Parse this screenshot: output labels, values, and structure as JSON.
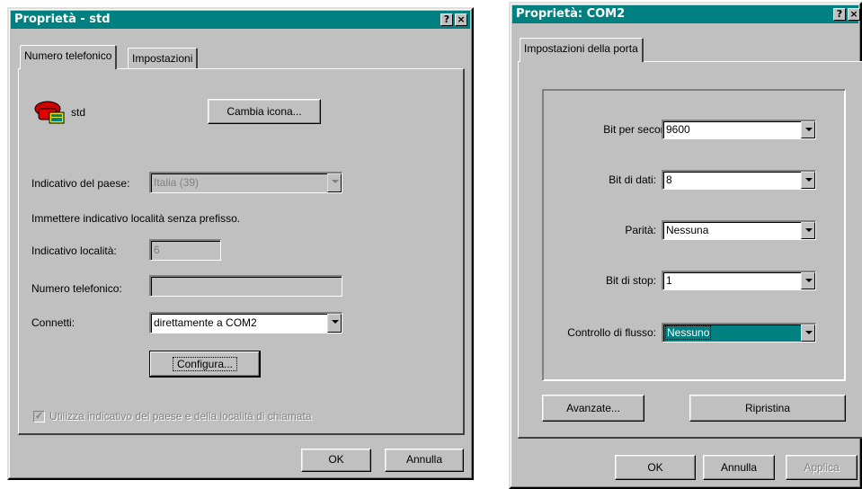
{
  "left_window": {
    "title": "Proprietà - std",
    "help_glyph": "?",
    "close_glyph": "×",
    "tabs": [
      "Numero telefonico",
      "Impostazioni"
    ],
    "connection_name": "std",
    "change_icon_button": "Cambia icona...",
    "country_code_label": "Indicativo del paese:",
    "country_code_value": "Italia (39)",
    "hint_text": "Immettere indicativo località senza prefisso.",
    "area_code_label": "Indicativo località:",
    "area_code_value": "6",
    "phone_number_label": "Numero telefonico:",
    "phone_number_value": "",
    "connect_label": "Connetti:",
    "connect_value": "direttamente a COM2",
    "configure_button": "Configura...",
    "use_codes_checkbox": "Utilizza indicativo del paese e della località di chiamata",
    "ok_button": "OK",
    "cancel_button": "Annulla"
  },
  "right_window": {
    "title": "Proprietà: COM2",
    "help_glyph": "?",
    "close_glyph": "×",
    "tabs": [
      "Impostazioni della porta"
    ],
    "bits_per_second_label": "Bit per secondo:",
    "bits_per_second_value": "9600",
    "data_bits_label": "Bit di dati:",
    "data_bits_value": "8",
    "parity_label": "Parità:",
    "parity_value": "Nessuna",
    "stop_bits_label": "Bit di stop:",
    "stop_bits_value": "1",
    "flow_control_label": "Controllo di flusso:",
    "flow_control_value": "Nessuno",
    "advanced_button": "Avanzate...",
    "restore_button": "Ripristina",
    "ok_button": "OK",
    "cancel_button": "Annulla",
    "apply_button": "Applica"
  },
  "colors": {
    "titlebar": "#008080",
    "face": "#c0c0c0",
    "selection": "#008080"
  }
}
